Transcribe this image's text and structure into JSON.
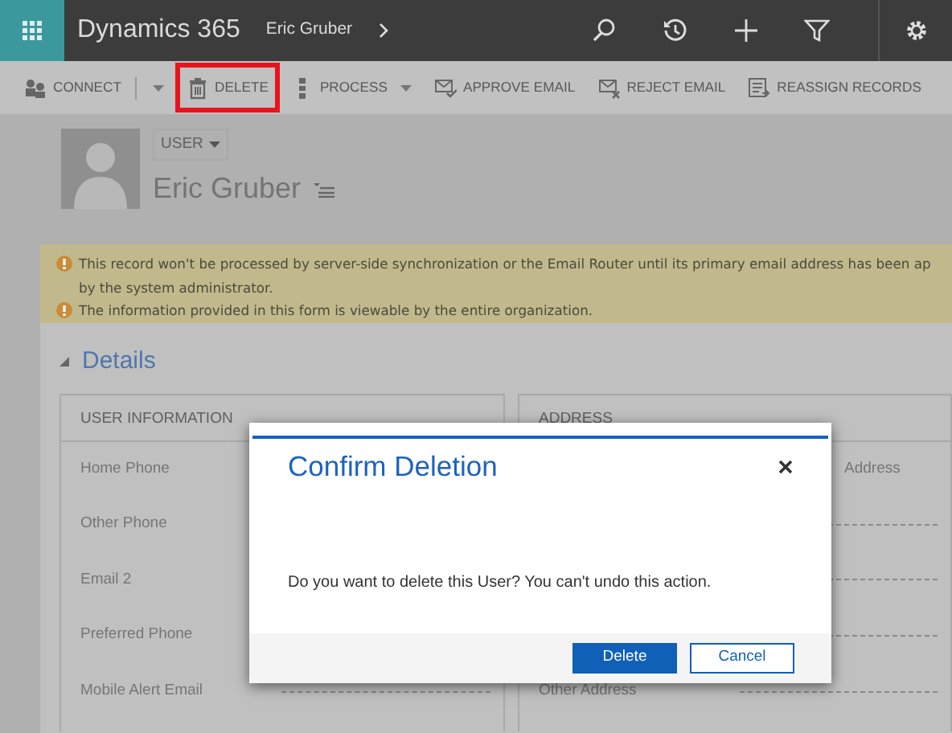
{
  "top_bar": {
    "app_title": "Dynamics 365",
    "breadcrumb": "Eric Gruber"
  },
  "commands": [
    {
      "label": "CONNECT",
      "dropdown": true,
      "highlighted": false
    },
    {
      "label": "DELETE",
      "dropdown": false,
      "highlighted": true
    },
    {
      "label": "PROCESS",
      "dropdown": true,
      "highlighted": false
    },
    {
      "label": "APPROVE EMAIL",
      "dropdown": false,
      "highlighted": false
    },
    {
      "label": "REJECT EMAIL",
      "dropdown": false,
      "highlighted": false
    },
    {
      "label": "REASSIGN RECORDS",
      "dropdown": false,
      "highlighted": false
    }
  ],
  "record": {
    "entity": "USER",
    "name": "Eric Gruber"
  },
  "notifications": [
    {
      "lines": [
        "This record won't be processed by server-side synchronization or the Email Router until its primary email address has been ap",
        "by the system administrator."
      ]
    },
    {
      "lines": [
        "The information provided in this form is viewable by the entire organization."
      ]
    }
  ],
  "section": {
    "title": "Details",
    "expanded": true
  },
  "columns": [
    {
      "title": "USER INFORMATION",
      "fields": [
        {
          "label": "Home Phone"
        },
        {
          "label": "Other Phone"
        },
        {
          "label": "Email 2"
        },
        {
          "label": "Preferred Phone"
        },
        {
          "label": "Mobile Alert Email"
        }
      ]
    },
    {
      "title": "ADDRESS",
      "fields": [
        {
          "label": "Address"
        },
        {
          "label": "Other Address"
        }
      ]
    }
  ],
  "dialog": {
    "title": "Confirm Deletion",
    "message": "Do you want to delete this User? You can't undo this action.",
    "buttons": [
      {
        "label": "Delete",
        "primary": true
      },
      {
        "label": "Cancel",
        "primary": false
      }
    ]
  }
}
